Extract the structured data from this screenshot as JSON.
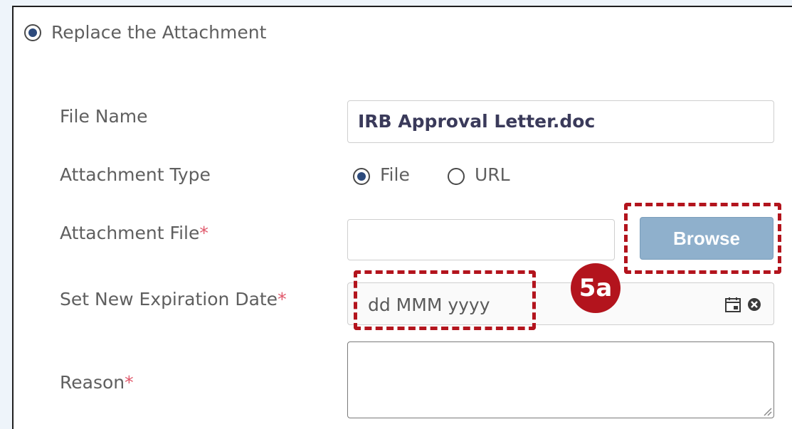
{
  "option": {
    "replace_label": "Replace the Attachment",
    "selected": true
  },
  "form": {
    "file_name_label": "File Name",
    "file_name_value": "IRB Approval Letter.doc",
    "attachment_type_label": "Attachment Type",
    "type_options": [
      {
        "label": "File",
        "selected": true
      },
      {
        "label": "URL",
        "selected": false
      }
    ],
    "attachment_file_label": "Attachment File",
    "attachment_file_value": "",
    "browse_label": "Browse",
    "expiration_label": "Set New Expiration Date",
    "expiration_placeholder": "dd MMM yyyy",
    "reason_label": "Reason",
    "reason_value": "",
    "required_mark": "*"
  },
  "callout": {
    "badge": "5a"
  },
  "colors": {
    "accent_selected": "#2c4a7c",
    "browse_button": "#8fb0cc",
    "callout_red": "#b3141d",
    "required": "#e0576a",
    "page_background": "#eef4fa"
  },
  "icons": {
    "calendar": "calendar-icon",
    "clear": "clear-icon",
    "resize": "resize-handle-icon"
  }
}
